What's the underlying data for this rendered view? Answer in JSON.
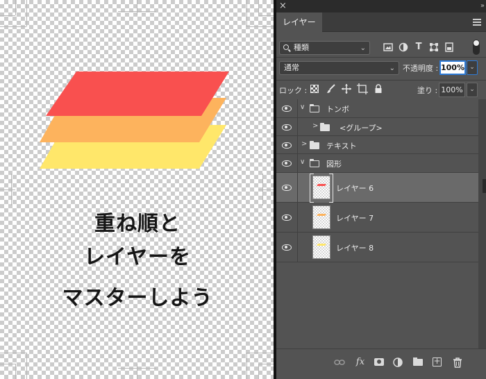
{
  "canvas": {
    "caption_lines": [
      "重ね順と",
      "レイヤーを",
      "マスターしよう"
    ],
    "artwork_colors": {
      "top": "#F9504F",
      "middle": "#FDB35D",
      "bottom": "#FFE76A"
    }
  },
  "panel": {
    "close_glyph": "×",
    "collapse_glyph": "»",
    "tab_label": "レイヤー",
    "filter": {
      "value": "種類"
    },
    "blend_mode": "通常",
    "opacity_label": "不透明度 :",
    "opacity_value": "100%",
    "lock_label": "ロック :",
    "fill_label": "塗り :",
    "fill_value": "100%",
    "layers": [
      {
        "name": "トンボ",
        "kind": "group",
        "expanded": true,
        "indent": 0
      },
      {
        "name": "<グループ>",
        "kind": "group",
        "expanded": false,
        "indent": 1
      },
      {
        "name": "テキスト",
        "kind": "group",
        "expanded": false,
        "indent": 0
      },
      {
        "name": "図形",
        "kind": "group",
        "expanded": true,
        "indent": 0
      },
      {
        "name": "レイヤー 6",
        "kind": "layer",
        "selected": true,
        "thumb_color": "#F9504F"
      },
      {
        "name": "レイヤー 7",
        "kind": "layer",
        "selected": false,
        "thumb_color": "#FDB35D"
      },
      {
        "name": "レイヤー 8",
        "kind": "layer",
        "selected": false,
        "thumb_color": "#FFE76A"
      }
    ],
    "footer_icons": [
      "link-icon",
      "fx-icon",
      "mask-icon",
      "adjustment-icon",
      "folder-icon",
      "new-layer-icon",
      "trash-icon"
    ],
    "fx_label": "fx"
  }
}
